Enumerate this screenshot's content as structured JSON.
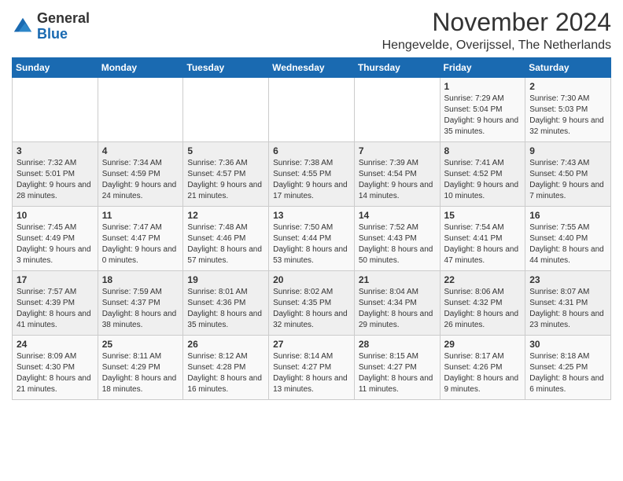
{
  "header": {
    "logo_general": "General",
    "logo_blue": "Blue",
    "month_title": "November 2024",
    "location": "Hengevelde, Overijssel, The Netherlands"
  },
  "weekdays": [
    "Sunday",
    "Monday",
    "Tuesday",
    "Wednesday",
    "Thursday",
    "Friday",
    "Saturday"
  ],
  "weeks": [
    [
      {
        "day": "",
        "info": ""
      },
      {
        "day": "",
        "info": ""
      },
      {
        "day": "",
        "info": ""
      },
      {
        "day": "",
        "info": ""
      },
      {
        "day": "",
        "info": ""
      },
      {
        "day": "1",
        "info": "Sunrise: 7:29 AM\nSunset: 5:04 PM\nDaylight: 9 hours and 35 minutes."
      },
      {
        "day": "2",
        "info": "Sunrise: 7:30 AM\nSunset: 5:03 PM\nDaylight: 9 hours and 32 minutes."
      }
    ],
    [
      {
        "day": "3",
        "info": "Sunrise: 7:32 AM\nSunset: 5:01 PM\nDaylight: 9 hours and 28 minutes."
      },
      {
        "day": "4",
        "info": "Sunrise: 7:34 AM\nSunset: 4:59 PM\nDaylight: 9 hours and 24 minutes."
      },
      {
        "day": "5",
        "info": "Sunrise: 7:36 AM\nSunset: 4:57 PM\nDaylight: 9 hours and 21 minutes."
      },
      {
        "day": "6",
        "info": "Sunrise: 7:38 AM\nSunset: 4:55 PM\nDaylight: 9 hours and 17 minutes."
      },
      {
        "day": "7",
        "info": "Sunrise: 7:39 AM\nSunset: 4:54 PM\nDaylight: 9 hours and 14 minutes."
      },
      {
        "day": "8",
        "info": "Sunrise: 7:41 AM\nSunset: 4:52 PM\nDaylight: 9 hours and 10 minutes."
      },
      {
        "day": "9",
        "info": "Sunrise: 7:43 AM\nSunset: 4:50 PM\nDaylight: 9 hours and 7 minutes."
      }
    ],
    [
      {
        "day": "10",
        "info": "Sunrise: 7:45 AM\nSunset: 4:49 PM\nDaylight: 9 hours and 3 minutes."
      },
      {
        "day": "11",
        "info": "Sunrise: 7:47 AM\nSunset: 4:47 PM\nDaylight: 9 hours and 0 minutes."
      },
      {
        "day": "12",
        "info": "Sunrise: 7:48 AM\nSunset: 4:46 PM\nDaylight: 8 hours and 57 minutes."
      },
      {
        "day": "13",
        "info": "Sunrise: 7:50 AM\nSunset: 4:44 PM\nDaylight: 8 hours and 53 minutes."
      },
      {
        "day": "14",
        "info": "Sunrise: 7:52 AM\nSunset: 4:43 PM\nDaylight: 8 hours and 50 minutes."
      },
      {
        "day": "15",
        "info": "Sunrise: 7:54 AM\nSunset: 4:41 PM\nDaylight: 8 hours and 47 minutes."
      },
      {
        "day": "16",
        "info": "Sunrise: 7:55 AM\nSunset: 4:40 PM\nDaylight: 8 hours and 44 minutes."
      }
    ],
    [
      {
        "day": "17",
        "info": "Sunrise: 7:57 AM\nSunset: 4:39 PM\nDaylight: 8 hours and 41 minutes."
      },
      {
        "day": "18",
        "info": "Sunrise: 7:59 AM\nSunset: 4:37 PM\nDaylight: 8 hours and 38 minutes."
      },
      {
        "day": "19",
        "info": "Sunrise: 8:01 AM\nSunset: 4:36 PM\nDaylight: 8 hours and 35 minutes."
      },
      {
        "day": "20",
        "info": "Sunrise: 8:02 AM\nSunset: 4:35 PM\nDaylight: 8 hours and 32 minutes."
      },
      {
        "day": "21",
        "info": "Sunrise: 8:04 AM\nSunset: 4:34 PM\nDaylight: 8 hours and 29 minutes."
      },
      {
        "day": "22",
        "info": "Sunrise: 8:06 AM\nSunset: 4:32 PM\nDaylight: 8 hours and 26 minutes."
      },
      {
        "day": "23",
        "info": "Sunrise: 8:07 AM\nSunset: 4:31 PM\nDaylight: 8 hours and 23 minutes."
      }
    ],
    [
      {
        "day": "24",
        "info": "Sunrise: 8:09 AM\nSunset: 4:30 PM\nDaylight: 8 hours and 21 minutes."
      },
      {
        "day": "25",
        "info": "Sunrise: 8:11 AM\nSunset: 4:29 PM\nDaylight: 8 hours and 18 minutes."
      },
      {
        "day": "26",
        "info": "Sunrise: 8:12 AM\nSunset: 4:28 PM\nDaylight: 8 hours and 16 minutes."
      },
      {
        "day": "27",
        "info": "Sunrise: 8:14 AM\nSunset: 4:27 PM\nDaylight: 8 hours and 13 minutes."
      },
      {
        "day": "28",
        "info": "Sunrise: 8:15 AM\nSunset: 4:27 PM\nDaylight: 8 hours and 11 minutes."
      },
      {
        "day": "29",
        "info": "Sunrise: 8:17 AM\nSunset: 4:26 PM\nDaylight: 8 hours and 9 minutes."
      },
      {
        "day": "30",
        "info": "Sunrise: 8:18 AM\nSunset: 4:25 PM\nDaylight: 8 hours and 6 minutes."
      }
    ]
  ]
}
